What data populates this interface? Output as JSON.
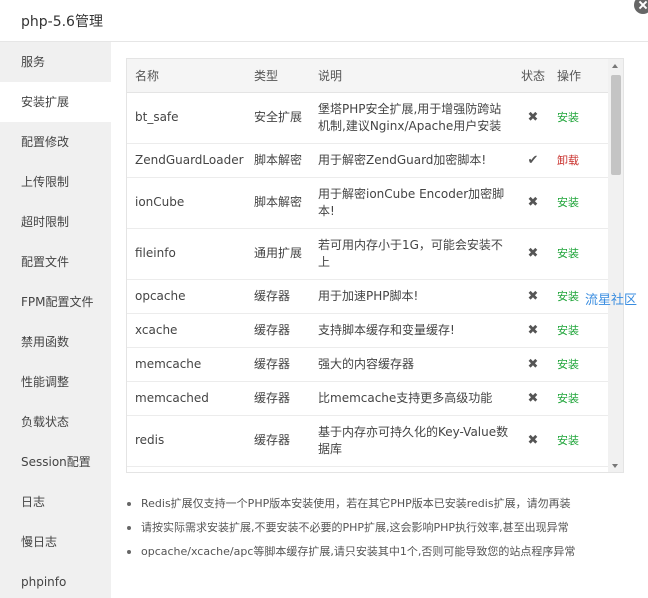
{
  "window": {
    "title": "php-5.6管理"
  },
  "sidebar": {
    "active": "安装扩展",
    "items": [
      {
        "label": "服务"
      },
      {
        "label": "安装扩展"
      },
      {
        "label": "配置修改"
      },
      {
        "label": "上传限制"
      },
      {
        "label": "超时限制"
      },
      {
        "label": "配置文件"
      },
      {
        "label": "FPM配置文件"
      },
      {
        "label": "禁用函数"
      },
      {
        "label": "性能调整"
      },
      {
        "label": "负载状态"
      },
      {
        "label": "Session配置"
      },
      {
        "label": "日志"
      },
      {
        "label": "慢日志"
      },
      {
        "label": "phpinfo"
      }
    ]
  },
  "table": {
    "headers": {
      "name": "名称",
      "type": "类型",
      "desc": "说明",
      "status": "状态",
      "op": "操作"
    },
    "rows": [
      {
        "name": "bt_safe",
        "type": "安全扩展",
        "desc": "堡塔PHP安全扩展,用于增强防跨站机制,建议Nginx/Apache用户安装",
        "status": "✖",
        "op": "安装",
        "installed": false
      },
      {
        "name": "ZendGuardLoader",
        "type": "脚本解密",
        "desc": "用于解密ZendGuard加密脚本!",
        "status": "✔",
        "op": "卸载",
        "installed": true
      },
      {
        "name": "ionCube",
        "type": "脚本解密",
        "desc": "用于解密ionCube Encoder加密脚本!",
        "status": "✖",
        "op": "安装",
        "installed": false
      },
      {
        "name": "fileinfo",
        "type": "通用扩展",
        "desc": "若可用内存小于1G，可能会安装不上",
        "status": "✖",
        "op": "安装",
        "installed": false
      },
      {
        "name": "opcache",
        "type": "缓存器",
        "desc": "用于加速PHP脚本!",
        "status": "✖",
        "op": "安装",
        "installed": false
      },
      {
        "name": "xcache",
        "type": "缓存器",
        "desc": "支持脚本缓存和变量缓存!",
        "status": "✖",
        "op": "安装",
        "installed": false
      },
      {
        "name": "memcache",
        "type": "缓存器",
        "desc": "强大的内容缓存器",
        "status": "✖",
        "op": "安装",
        "installed": false
      },
      {
        "name": "memcached",
        "type": "缓存器",
        "desc": "比memcache支持更多高级功能",
        "status": "✖",
        "op": "安装",
        "installed": false
      },
      {
        "name": "redis",
        "type": "缓存器",
        "desc": "基于内存亦可持久化的Key-Value数据库",
        "status": "✖",
        "op": "安装",
        "installed": false
      }
    ]
  },
  "notes": [
    "Redis扩展仅支持一个PHP版本安装使用，若在其它PHP版本已安装redis扩展，请勿再装",
    "请按实际需求安装扩展,不要安装不必要的PHP扩展,这会影响PHP执行效率,甚至出现异常",
    "opcache/xcache/apc等脚本缓存扩展,请只安装其中1个,否则可能导致您的站点程序异常"
  ],
  "watermark": "流星社区",
  "colors": {
    "install": "#20a53a",
    "uninstall": "#c9302c",
    "sidebar_bg": "#f0f0f0"
  }
}
